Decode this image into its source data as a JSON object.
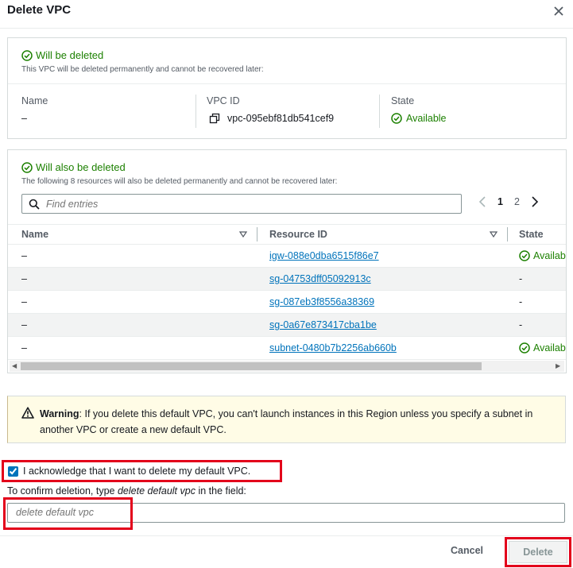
{
  "dialog": {
    "title": "Delete VPC"
  },
  "vpc_panel": {
    "heading": "Will be deleted",
    "subtext": "This VPC will be deleted permanently and cannot be recovered later:",
    "name_label": "Name",
    "name_value": "–",
    "vpc_id_label": "VPC ID",
    "vpc_id_value": "vpc-095ebf81db541cef9",
    "state_label": "State",
    "state_value": "Available"
  },
  "resources_panel": {
    "heading": "Will also be deleted",
    "subtext": "The following 8 resources will also be deleted permanently and cannot be recovered later:",
    "search_placeholder": "Find entries",
    "pages": [
      "1",
      "2"
    ],
    "current_page": "1",
    "columns": [
      "Name",
      "Resource ID",
      "State"
    ],
    "rows": [
      {
        "name": "–",
        "resource_id": "igw-088e0dba6515f86e7",
        "state": "Availab"
      },
      {
        "name": "–",
        "resource_id": "sg-04753dff05092913c",
        "state": "-"
      },
      {
        "name": "–",
        "resource_id": "sg-087eb3f8556a38369",
        "state": "-"
      },
      {
        "name": "–",
        "resource_id": "sg-0a67e873417cba1be",
        "state": "-"
      },
      {
        "name": "–",
        "resource_id": "subnet-0480b7b2256ab660b",
        "state": "Availab"
      }
    ]
  },
  "warning": {
    "label": "Warning",
    "text": ": If you delete this default VPC, you can't launch instances in this Region unless you specify a subnet in another VPC or create a new default VPC."
  },
  "acknowledge": {
    "label": "I acknowledge that I want to delete my default VPC.",
    "checked": true
  },
  "confirm": {
    "label_prefix": "To confirm deletion, type ",
    "label_phrase": "delete default vpc",
    "label_suffix": " in the field:",
    "placeholder": "delete default vpc"
  },
  "footer": {
    "cancel_label": "Cancel",
    "delete_label": "Delete"
  },
  "colors": {
    "success": "#1d8102",
    "link": "#0073bb",
    "highlight": "#e3001b",
    "warning_bg": "#fffce6"
  }
}
